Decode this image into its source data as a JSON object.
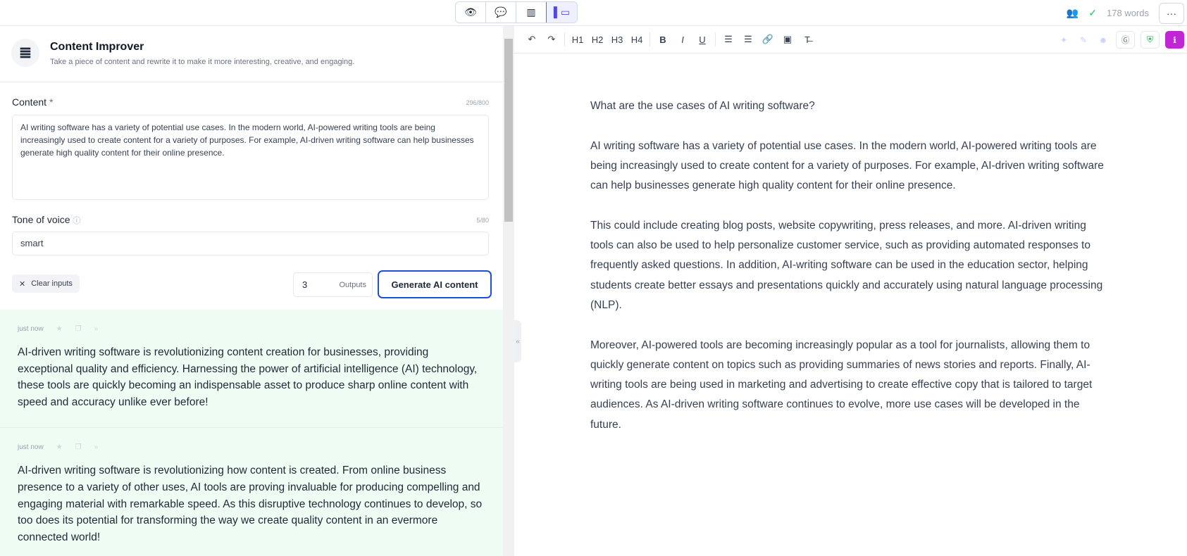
{
  "topbar": {
    "view_toggles": [
      {
        "icon": "eye-icon"
      },
      {
        "icon": "chat-icon"
      },
      {
        "icon": "chart-icon"
      },
      {
        "icon": "sidebar-panel-icon",
        "active": true
      }
    ],
    "word_count": "178 words",
    "more": "···"
  },
  "tool": {
    "title": "Content Improver",
    "description": "Take a piece of content and rewrite it to make it more interesting, creative, and engaging."
  },
  "form": {
    "content_label": "Content",
    "required_mark": "*",
    "content_count": "296/800",
    "content_value": "AI writing software has a variety of potential use cases. In the modern world, AI-powered writing tools are being increasingly used to create content for a variety of purposes. For example, AI-driven writing software can help businesses generate high quality content for their online presence.",
    "tone_label": "Tone of voice",
    "tone_count": "5/80",
    "tone_value": "smart",
    "clear_label": "Clear inputs",
    "outputs_value": "3",
    "outputs_label": "Outputs",
    "generate_label": "Generate AI content"
  },
  "results": [
    {
      "time": "just now",
      "text": "AI-driven writing software is revolutionizing content creation for businesses, providing exceptional quality and efficiency. Harnessing the power of artificial intelligence (AI) technology, these tools are quickly becoming an indispensable asset to produce sharp online content with speed and accuracy unlike ever before!"
    },
    {
      "time": "just now",
      "text": "AI-driven writing software is revolutionizing how content is created. From online business presence to a variety of other uses, AI tools are proving invaluable for producing compelling and engaging material with remarkable speed. As this disruptive technology continues to develop, so too does its potential for transforming the way we create quality content in an evermore connected world!"
    }
  ],
  "toolbar": {
    "undo": "↶",
    "redo": "↷",
    "h1": "H1",
    "h2": "H2",
    "h3": "H3",
    "h4": "H4",
    "bold": "B",
    "italic": "I",
    "underline": "U",
    "ol": "☰",
    "ul": "☰",
    "link": "🔗",
    "image": "▣",
    "clear": "T̶"
  },
  "colors": {
    "accent": "#1d4ed8",
    "results_bg": "#effcf3",
    "shield": "#16a34a",
    "info": "#c026d3"
  },
  "editor": {
    "paragraphs": [
      "What are the use cases of AI writing software?",
      "AI writing software has a variety of potential use cases. In the modern world, AI-powered writing tools are being increasingly used to create content for a variety of purposes. For example, AI-driven writing software can help businesses generate high quality content for their online presence.",
      "This could include creating blog posts, website copywriting, press releases, and more. AI-driven writing tools can also be used to help personalize customer service, such as providing automated responses to frequently asked questions. In addition, AI-writing software can be used in the education sector, helping students create better essays and presentations quickly and accurately using natural language processing (NLP).",
      "Moreover, AI-powered tools are becoming increasingly popular as a tool for journalists, allowing them to quickly generate content on topics such as providing summaries of news stories and reports. Finally, AI-writing tools are being used in marketing and advertising to create effective copy that is tailored to target audiences. As AI-driven writing software continues to evolve, more use cases will be developed in the future."
    ]
  }
}
